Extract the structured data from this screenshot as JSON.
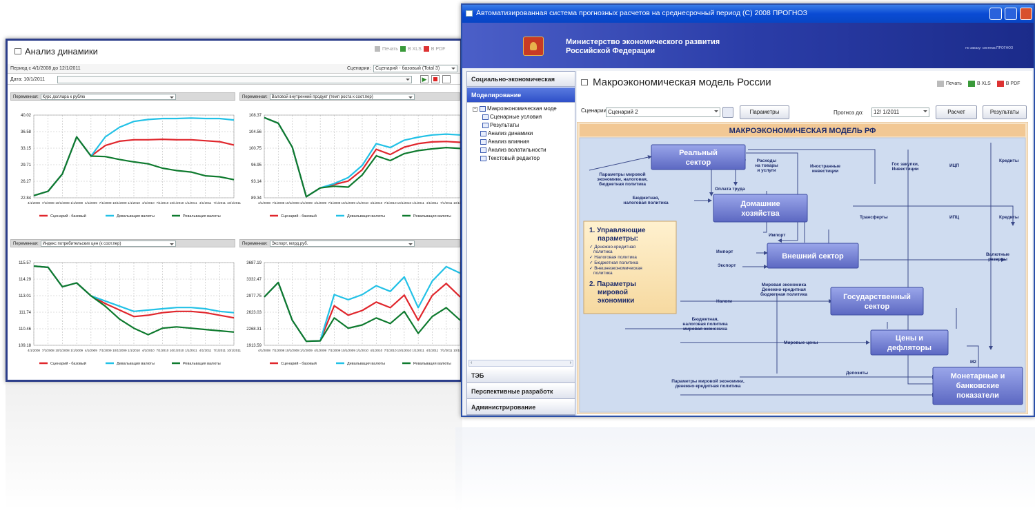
{
  "left_window": {
    "title": "Анализ динамики",
    "toolbar": {
      "print": "Печать",
      "xls": "B XLS",
      "pdf": "B PDF"
    },
    "period_label": "Период с 4/1/2008 до 12/1/2011",
    "scenario_label": "Сценарии:",
    "scenario_value": "Сценарий - базовый (Total 3)",
    "date_label": "Дата: 10/1/2011",
    "indicator_label": "Переменная:",
    "panels": [
      {
        "indicator": "Курс доллара к рублю"
      },
      {
        "indicator": "Валовой внутренний продукт (темп роста к соот.пер)"
      },
      {
        "indicator": "Индекс потребительских цен (к соот.пер)"
      },
      {
        "indicator": "Экспорт, млрд.руб."
      }
    ],
    "legend": [
      "Сценарий - базовый",
      "Девальвация валюты",
      "Ревальвация валюты"
    ]
  },
  "chart_data": [
    {
      "type": "line",
      "categories": [
        "4/1/2008",
        "7/1/2008",
        "10/1/2008",
        "1/1/2009",
        "4/1/2009",
        "7/1/2009",
        "10/1/2009",
        "1/1/2010",
        "4/1/2010",
        "7/1/2010",
        "10/1/2010",
        "1/1/2011",
        "4/1/2011",
        "7/1/2011",
        "10/1/2011"
      ],
      "yticks": [
        "40.02",
        "36.58",
        "33.15",
        "29.71",
        "26.27",
        "22.84"
      ],
      "ylim": [
        22.84,
        40.02
      ],
      "series": [
        {
          "name": "Сценарий - базовый",
          "color": "#e0262c",
          "values": [
            23.3,
            24.2,
            27.8,
            35.5,
            31.5,
            33.7,
            34.6,
            34.9,
            34.9,
            35.0,
            34.9,
            34.9,
            34.7,
            34.5,
            33.8
          ]
        },
        {
          "name": "Девальвация валюты",
          "color": "#22c1e6",
          "values": [
            23.3,
            24.2,
            27.8,
            35.5,
            31.5,
            35.5,
            37.5,
            38.7,
            39.1,
            39.3,
            39.3,
            39.4,
            39.3,
            39.3,
            39.0
          ]
        },
        {
          "name": "Ревальвация валюты",
          "color": "#0e7a2e",
          "values": [
            23.3,
            24.2,
            27.8,
            35.5,
            31.5,
            31.4,
            30.8,
            30.3,
            29.9,
            29.0,
            28.5,
            28.2,
            27.4,
            27.2,
            26.6
          ]
        }
      ]
    },
    {
      "type": "line",
      "categories": [
        "4/1/2008",
        "7/1/2008",
        "10/1/2008",
        "1/1/2009",
        "4/1/2009",
        "7/1/2009",
        "10/1/2009",
        "1/1/2010",
        "4/1/2010",
        "7/1/2010",
        "10/1/2010",
        "1/1/2011",
        "4/1/2011",
        "7/1/2011",
        "10/1/2011"
      ],
      "yticks": [
        "108.37",
        "104.56",
        "100.75",
        "96.95",
        "93.14",
        "89.34"
      ],
      "ylim": [
        89.34,
        108.37
      ],
      "series": [
        {
          "name": "Сценарий - базовый",
          "color": "#e0262c",
          "values": [
            107.8,
            106.5,
            101.0,
            89.6,
            91.6,
            92.4,
            93.2,
            95.8,
            100.5,
            99.3,
            101.0,
            101.8,
            102.2,
            102.3,
            102.1
          ]
        },
        {
          "name": "Девальвация валюты",
          "color": "#22c1e6",
          "values": [
            107.8,
            106.5,
            101.0,
            89.6,
            91.6,
            92.6,
            94.0,
            96.8,
            101.8,
            100.9,
            102.6,
            103.3,
            103.8,
            104.0,
            103.8
          ]
        },
        {
          "name": "Ревальвация валюты",
          "color": "#0e7a2e",
          "values": [
            107.8,
            106.5,
            101.0,
            89.6,
            91.6,
            92.0,
            91.8,
            94.6,
            99.0,
            97.9,
            99.5,
            100.2,
            100.6,
            100.9,
            100.7
          ]
        }
      ]
    },
    {
      "type": "line",
      "categories": [
        "4/1/2008",
        "7/1/2008",
        "10/1/2008",
        "1/1/2009",
        "4/1/2009",
        "7/1/2009",
        "10/1/2009",
        "1/1/2010",
        "4/1/2010",
        "7/1/2010",
        "10/1/2010",
        "1/1/2011",
        "4/1/2011",
        "7/1/2011",
        "10/1/2011"
      ],
      "yticks": [
        "115.57",
        "114.29",
        "113.01",
        "111.74",
        "110.46",
        "109.18"
      ],
      "ylim": [
        109.18,
        115.57
      ],
      "series": [
        {
          "name": "Сценарий - базовый",
          "color": "#e0262c",
          "values": [
            115.3,
            115.2,
            113.7,
            114.0,
            113.0,
            112.4,
            111.9,
            111.4,
            111.5,
            111.7,
            111.8,
            111.8,
            111.7,
            111.5,
            111.3
          ]
        },
        {
          "name": "Девальвация валюты",
          "color": "#22c1e6",
          "values": [
            115.3,
            115.2,
            113.7,
            114.0,
            113.0,
            112.6,
            112.2,
            111.8,
            111.9,
            112.0,
            112.1,
            112.1,
            112.0,
            111.8,
            111.7
          ]
        },
        {
          "name": "Ревальвация валюты",
          "color": "#0e7a2e",
          "values": [
            115.3,
            115.2,
            113.7,
            114.0,
            113.0,
            112.2,
            111.2,
            110.5,
            110.0,
            110.5,
            110.6,
            110.5,
            110.4,
            110.3,
            110.2
          ]
        }
      ]
    },
    {
      "type": "line",
      "categories": [
        "4/1/2008",
        "7/1/2008",
        "10/1/2008",
        "1/1/2009",
        "4/1/2009",
        "7/1/2009",
        "10/1/2009",
        "1/1/2010",
        "4/1/2010",
        "7/1/2010",
        "10/1/2010",
        "1/1/2011",
        "4/1/2011",
        "7/1/2011",
        "10/1/2011"
      ],
      "yticks": [
        "3687.19",
        "3332.47",
        "2977.75",
        "2623.03",
        "2268.31",
        "1913.59"
      ],
      "ylim": [
        1913.59,
        3687.19
      ],
      "series": [
        {
          "name": "Сценарий - базовый",
          "color": "#e0262c",
          "values": [
            2950,
            3260,
            2450,
            2000,
            2010,
            2760,
            2560,
            2660,
            2840,
            2720,
            2990,
            2450,
            2980,
            3240,
            2950
          ]
        },
        {
          "name": "Девальвация валюты",
          "color": "#22c1e6",
          "values": [
            2950,
            3260,
            2450,
            2000,
            2010,
            3000,
            2890,
            3000,
            3190,
            3070,
            3380,
            2720,
            3290,
            3600,
            3460
          ]
        },
        {
          "name": "Ревальвация валюты",
          "color": "#0e7a2e",
          "values": [
            2950,
            3260,
            2450,
            2000,
            2010,
            2500,
            2280,
            2350,
            2500,
            2380,
            2640,
            2170,
            2530,
            2720,
            2450
          ]
        }
      ]
    }
  ],
  "right_window": {
    "titlebar": "Автоматизированная система прогнозных расчетов на среднесрочный период (С) 2008 ПРОГНОЗ",
    "banner_line1": "Министерство экономического развития",
    "banner_line2": "Российской Федерации",
    "banner_small": "по заказу: система ПРОГНОЗ",
    "sidebar": {
      "top": "Социально-экономическая",
      "active": "Моделирование",
      "tree": [
        {
          "label": "Макроэкономическая моде",
          "level": 0,
          "expand": "−"
        },
        {
          "label": "Сценарные условия",
          "level": 1
        },
        {
          "label": "Результаты",
          "level": 1
        },
        {
          "label": "Анализ динамики",
          "level": 0
        },
        {
          "label": "Анализ влияния",
          "level": 0
        },
        {
          "label": "Анализ волатильности",
          "level": 0
        },
        {
          "label": "Текстовый редактор",
          "level": 0
        }
      ],
      "bottom": [
        "ТЭБ",
        "Перспективные разработк",
        "Администрирование"
      ]
    },
    "main": {
      "title": "Макроэкономическая модель России",
      "print": "Печать",
      "xls": "B XLS",
      "pdf": "B PDF",
      "scenario_label": "Сценарии",
      "scenario_value": "Сценарий 2",
      "params_button": "Параметры",
      "forecast_label": "Прогноз до:",
      "forecast_value": "12/ 1/2011",
      "calc_button": "Расчет",
      "results_button": "Результаты"
    },
    "diagram": {
      "title": "МАКРОЭКОНОМИЧЕСКАЯ МОДЕЛЬ РФ",
      "boxes": {
        "real": [
          "Реальный",
          "сектор"
        ],
        "house": [
          "Домашние",
          "хозяйства"
        ],
        "ext": [
          "Внешний сектор"
        ],
        "gov": [
          "Государственный",
          "сектор"
        ],
        "prices": [
          "Цены и",
          "дефляторы"
        ],
        "money": [
          "Монетарные и",
          "банковские",
          "показатели"
        ]
      },
      "params_box": {
        "h1": "1. Управляющие",
        "h1b": "параметры:",
        "items": [
          "Денежно-кредитная",
          "политика",
          "Налоговая политика",
          "Бюджетная политика",
          "Внешнеэкономическая",
          "политика"
        ],
        "h2": [
          "2. Параметры",
          "мировой",
          "экономики"
        ]
      },
      "labels": {
        "world_params": [
          "Параметры мировой",
          "экономики, налоговая,",
          "бюджетная политика"
        ],
        "spend": [
          "Расходы",
          "на товары",
          "и услуги"
        ],
        "foreign_inv": [
          "Иностранные",
          "инвестиции"
        ],
        "gov_purch": [
          "Гос закупки,",
          "Инвестиции"
        ],
        "cpi1": "ИЦП",
        "credits1": "Кредиты",
        "wage": "Оплата труда",
        "budget_tax": [
          "Бюджетная,",
          "налоговая политика"
        ],
        "transfers": "Трансферты",
        "cpi2": "ИПЦ",
        "credits2": "Кредиты",
        "import_arrow": "Импорт",
        "import": "Импорт",
        "export": "Экспорт",
        "fx_reserves": [
          "Валютные",
          "резервы"
        ],
        "world_econ": [
          "Мировая экономика",
          "Денежно-кредитная",
          "бюджетная политика"
        ],
        "taxes": "Налоги",
        "budget_tax_world": [
          "Бюджетная,",
          "налоговая политика",
          "мировая экономика"
        ],
        "world_prices": "Мировые цены",
        "m2": "M2",
        "deposits": "Депозиты",
        "bottom_params": [
          "Параметры мировой экономики,",
          "денежно-кредитная политика"
        ]
      }
    }
  }
}
